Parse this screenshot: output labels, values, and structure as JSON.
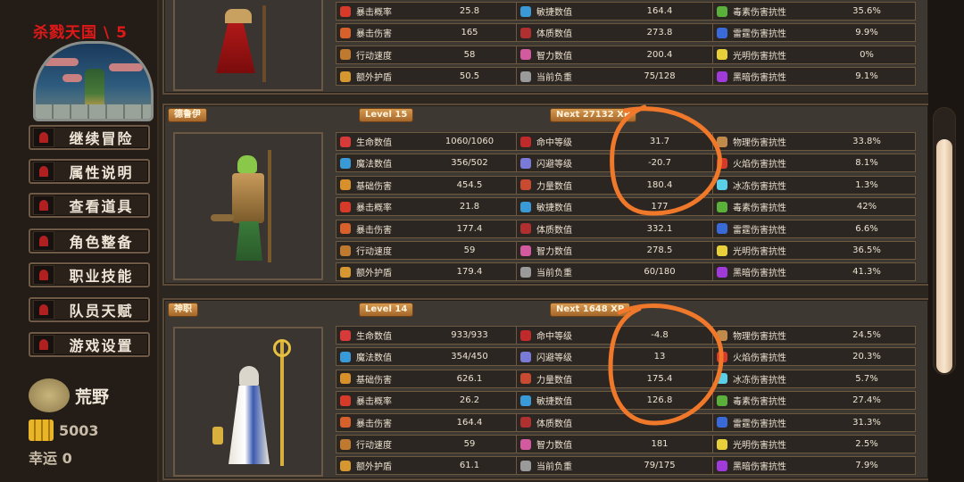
{
  "game_title": "杀戮天国 \\ 5",
  "menu": [
    {
      "label": "继续冒险"
    },
    {
      "label": "属性说明"
    },
    {
      "label": "查看道具"
    },
    {
      "label": "角色整备"
    },
    {
      "label": "职业技能"
    },
    {
      "label": "队员天赋"
    },
    {
      "label": "游戏设置"
    }
  ],
  "realm": "荒野",
  "gold": "5003",
  "luck": "幸运 0",
  "characters": [
    {
      "name": "",
      "level": "",
      "next_xp": "",
      "col1": [
        {
          "name": "暴击概率",
          "value": "25.8",
          "icon_color": "#d83a2a"
        },
        {
          "name": "暴击伤害",
          "value": "165",
          "icon_color": "#d8602a"
        },
        {
          "name": "行动速度",
          "value": "58",
          "icon_color": "#c07a30"
        },
        {
          "name": "额外护盾",
          "value": "50.5",
          "icon_color": "#d69630"
        }
      ],
      "col2": [
        {
          "name": "敏捷数值",
          "value": "164.4",
          "icon_color": "#3a9ad8"
        },
        {
          "name": "体质数值",
          "value": "273.8",
          "icon_color": "#b03030"
        },
        {
          "name": "智力数值",
          "value": "200.4",
          "icon_color": "#d45aa0"
        },
        {
          "name": "当前负重",
          "value": "75/128",
          "icon_color": "#9a9a9a"
        }
      ],
      "col3": [
        {
          "name": "毒素伤害抗性",
          "value": "35.6%",
          "icon_color": "#5ab03a"
        },
        {
          "name": "雷霆伤害抗性",
          "value": "9.9%",
          "icon_color": "#3a6ad8"
        },
        {
          "name": "光明伤害抗性",
          "value": "0%",
          "icon_color": "#e8d03a"
        },
        {
          "name": "黑暗伤害抗性",
          "value": "9.1%",
          "icon_color": "#a03ad8"
        }
      ]
    },
    {
      "name": "德鲁伊",
      "level": "Level 15",
      "next_xp": "Next 27132 XP",
      "col1": [
        {
          "name": "生命数值",
          "value": "1060/1060",
          "icon_color": "#d83a3a"
        },
        {
          "name": "魔法数值",
          "value": "356/502",
          "icon_color": "#3a9ad8"
        },
        {
          "name": "基础伤害",
          "value": "454.5",
          "icon_color": "#d8902a"
        },
        {
          "name": "暴击概率",
          "value": "21.8",
          "icon_color": "#d83a2a"
        },
        {
          "name": "暴击伤害",
          "value": "177.4",
          "icon_color": "#d8602a"
        },
        {
          "name": "行动速度",
          "value": "59",
          "icon_color": "#c07a30"
        },
        {
          "name": "额外护盾",
          "value": "179.4",
          "icon_color": "#d69630"
        }
      ],
      "col2": [
        {
          "name": "命中等级",
          "value": "31.7",
          "icon_color": "#c02a2a"
        },
        {
          "name": "闪避等级",
          "value": "-20.7",
          "icon_color": "#7a7ad8"
        },
        {
          "name": "力量数值",
          "value": "180.4",
          "icon_color": "#c84a30"
        },
        {
          "name": "敏捷数值",
          "value": "177",
          "icon_color": "#3a9ad8"
        },
        {
          "name": "体质数值",
          "value": "332.1",
          "icon_color": "#b03030"
        },
        {
          "name": "智力数值",
          "value": "278.5",
          "icon_color": "#d45aa0"
        },
        {
          "name": "当前负重",
          "value": "60/180",
          "icon_color": "#9a9a9a"
        }
      ],
      "col3": [
        {
          "name": "物理伤害抗性",
          "value": "33.8%",
          "icon_color": "#c08a4a"
        },
        {
          "name": "火焰伤害抗性",
          "value": "8.1%",
          "icon_color": "#d83a2a"
        },
        {
          "name": "冰冻伤害抗性",
          "value": "1.3%",
          "icon_color": "#5ad0e8"
        },
        {
          "name": "毒素伤害抗性",
          "value": "42%",
          "icon_color": "#5ab03a"
        },
        {
          "name": "雷霆伤害抗性",
          "value": "6.6%",
          "icon_color": "#3a6ad8"
        },
        {
          "name": "光明伤害抗性",
          "value": "36.5%",
          "icon_color": "#e8d03a"
        },
        {
          "name": "黑暗伤害抗性",
          "value": "41.3%",
          "icon_color": "#a03ad8"
        }
      ]
    },
    {
      "name": "神职",
      "level": "Level 14",
      "next_xp": "Next 1648 XP",
      "col1": [
        {
          "name": "生命数值",
          "value": "933/933",
          "icon_color": "#d83a3a"
        },
        {
          "name": "魔法数值",
          "value": "354/450",
          "icon_color": "#3a9ad8"
        },
        {
          "name": "基础伤害",
          "value": "626.1",
          "icon_color": "#d8902a"
        },
        {
          "name": "暴击概率",
          "value": "26.2",
          "icon_color": "#d83a2a"
        },
        {
          "name": "暴击伤害",
          "value": "164.4",
          "icon_color": "#d8602a"
        },
        {
          "name": "行动速度",
          "value": "59",
          "icon_color": "#c07a30"
        },
        {
          "name": "额外护盾",
          "value": "61.1",
          "icon_color": "#d69630"
        }
      ],
      "col2": [
        {
          "name": "命中等级",
          "value": "-4.8",
          "icon_color": "#c02a2a"
        },
        {
          "name": "闪避等级",
          "value": "13",
          "icon_color": "#7a7ad8"
        },
        {
          "name": "力量数值",
          "value": "175.4",
          "icon_color": "#c84a30"
        },
        {
          "name": "敏捷数值",
          "value": "126.8",
          "icon_color": "#3a9ad8"
        },
        {
          "name": "体质数值",
          "value": "",
          "icon_color": "#b03030"
        },
        {
          "name": "智力数值",
          "value": "181",
          "icon_color": "#d45aa0"
        },
        {
          "name": "当前负重",
          "value": "79/175",
          "icon_color": "#9a9a9a"
        }
      ],
      "col3": [
        {
          "name": "物理伤害抗性",
          "value": "24.5%",
          "icon_color": "#c08a4a"
        },
        {
          "name": "火焰伤害抗性",
          "value": "20.3%",
          "icon_color": "#d83a2a"
        },
        {
          "name": "冰冻伤害抗性",
          "value": "5.7%",
          "icon_color": "#5ad0e8"
        },
        {
          "name": "毒素伤害抗性",
          "value": "27.4%",
          "icon_color": "#5ab03a"
        },
        {
          "name": "雷霆伤害抗性",
          "value": "31.3%",
          "icon_color": "#3a6ad8"
        },
        {
          "name": "光明伤害抗性",
          "value": "2.5%",
          "icon_color": "#e8d03a"
        },
        {
          "name": "黑暗伤害抗性",
          "value": "7.9%",
          "icon_color": "#a03ad8"
        }
      ]
    }
  ],
  "annotation_color": "#f0782a"
}
